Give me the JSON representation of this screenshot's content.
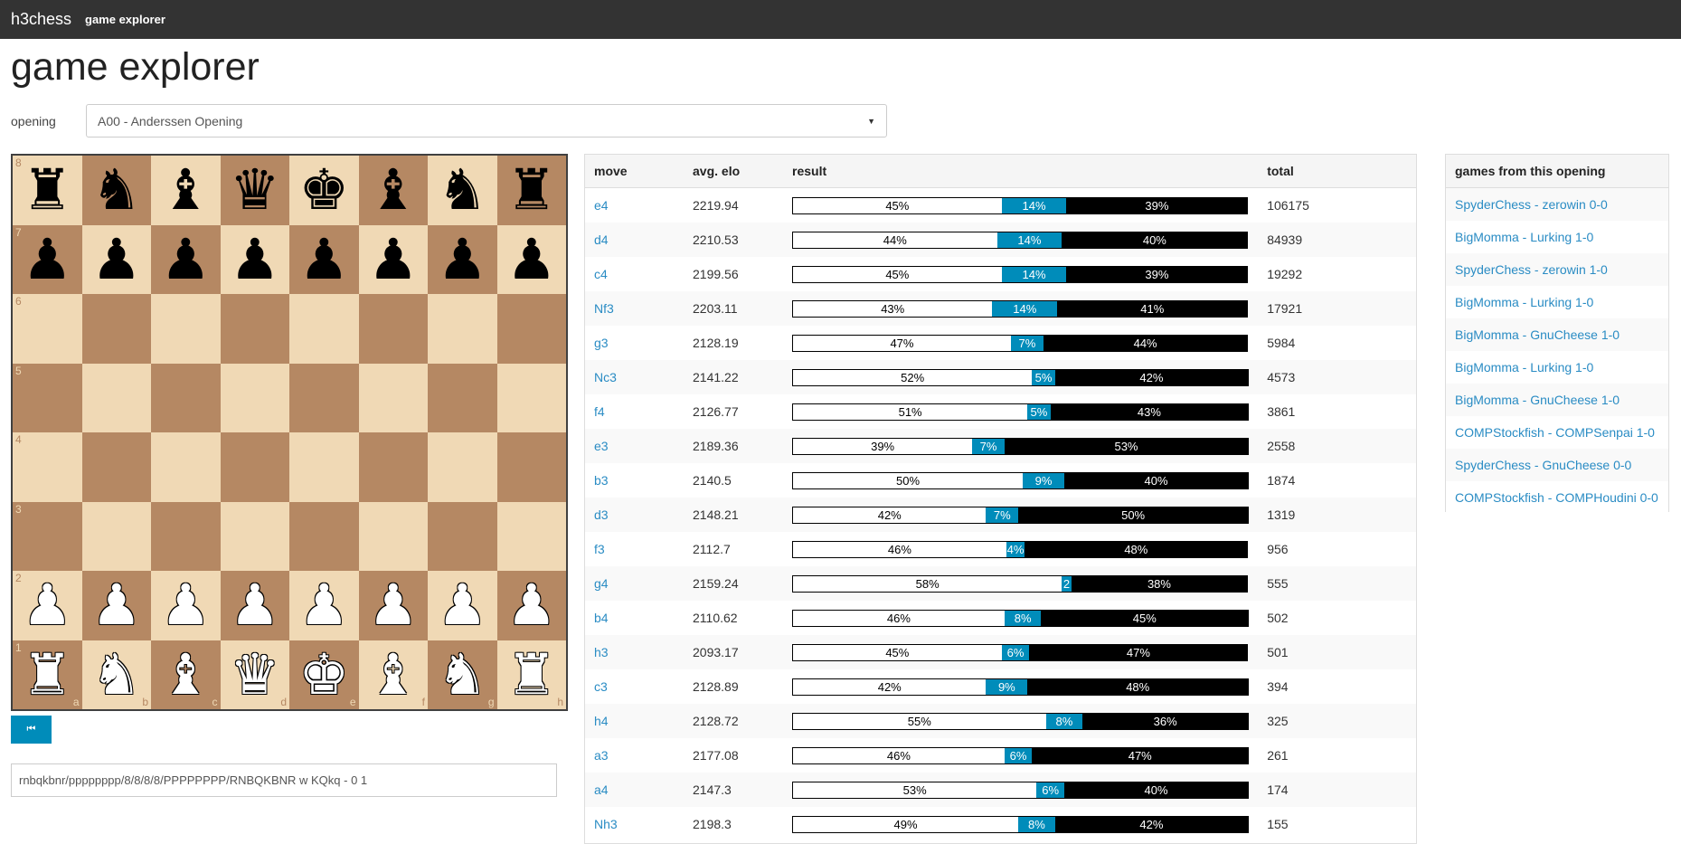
{
  "nav": {
    "brand": "h3chess",
    "link": "game explorer"
  },
  "page_title": "game explorer",
  "opening": {
    "label": "opening",
    "selected": "A00 - Anderssen Opening"
  },
  "board": {
    "ranks": [
      [
        "r",
        "n",
        "b",
        "q",
        "k",
        "b",
        "n",
        "r"
      ],
      [
        "p",
        "p",
        "p",
        "p",
        "p",
        "p",
        "p",
        "p"
      ],
      [
        "",
        "",
        "",
        "",
        "",
        "",
        "",
        ""
      ],
      [
        "",
        "",
        "",
        "",
        "",
        "",
        "",
        ""
      ],
      [
        "",
        "",
        "",
        "",
        "",
        "",
        "",
        ""
      ],
      [
        "",
        "",
        "",
        "",
        "",
        "",
        "",
        ""
      ],
      [
        "P",
        "P",
        "P",
        "P",
        "P",
        "P",
        "P",
        "P"
      ],
      [
        "R",
        "N",
        "B",
        "Q",
        "K",
        "B",
        "N",
        "R"
      ]
    ],
    "rank_labels": [
      "8",
      "7",
      "6",
      "5",
      "4",
      "3",
      "2",
      "1"
    ],
    "file_labels": [
      "a",
      "b",
      "c",
      "d",
      "e",
      "f",
      "g",
      "h"
    ]
  },
  "fen": "rnbqkbnr/pppppppp/8/8/8/8/PPPPPPPP/RNBQKBNR w KQkq - 0 1",
  "moves_table": {
    "headers": {
      "move": "move",
      "elo": "avg. elo",
      "result": "result",
      "total": "total"
    },
    "rows": [
      {
        "move": "e4",
        "elo": "2219.94",
        "w": 45,
        "d": 14,
        "b": 39,
        "w_label": "45%",
        "d_label": "14%",
        "b_label": "39%",
        "total": "106175"
      },
      {
        "move": "d4",
        "elo": "2210.53",
        "w": 44,
        "d": 14,
        "b": 40,
        "w_label": "44%",
        "d_label": "14%",
        "b_label": "40%",
        "total": "84939"
      },
      {
        "move": "c4",
        "elo": "2199.56",
        "w": 45,
        "d": 14,
        "b": 39,
        "w_label": "45%",
        "d_label": "14%",
        "b_label": "39%",
        "total": "19292"
      },
      {
        "move": "Nf3",
        "elo": "2203.11",
        "w": 43,
        "d": 14,
        "b": 41,
        "w_label": "43%",
        "d_label": "14%",
        "b_label": "41%",
        "total": "17921"
      },
      {
        "move": "g3",
        "elo": "2128.19",
        "w": 47,
        "d": 7,
        "b": 44,
        "w_label": "47%",
        "d_label": "7%",
        "b_label": "44%",
        "total": "5984"
      },
      {
        "move": "Nc3",
        "elo": "2141.22",
        "w": 52,
        "d": 5,
        "b": 42,
        "w_label": "52%",
        "d_label": "5%",
        "b_label": "42%",
        "total": "4573"
      },
      {
        "move": "f4",
        "elo": "2126.77",
        "w": 51,
        "d": 5,
        "b": 43,
        "w_label": "51%",
        "d_label": "5%",
        "b_label": "43%",
        "total": "3861"
      },
      {
        "move": "e3",
        "elo": "2189.36",
        "w": 39,
        "d": 7,
        "b": 53,
        "w_label": "39%",
        "d_label": "7%",
        "b_label": "53%",
        "total": "2558"
      },
      {
        "move": "b3",
        "elo": "2140.5",
        "w": 50,
        "d": 9,
        "b": 40,
        "w_label": "50%",
        "d_label": "9%",
        "b_label": "40%",
        "total": "1874"
      },
      {
        "move": "d3",
        "elo": "2148.21",
        "w": 42,
        "d": 7,
        "b": 50,
        "w_label": "42%",
        "d_label": "7%",
        "b_label": "50%",
        "total": "1319"
      },
      {
        "move": "f3",
        "elo": "2112.7",
        "w": 46,
        "d": 4,
        "b": 48,
        "w_label": "46%",
        "d_label": "4%",
        "b_label": "48%",
        "total": "956"
      },
      {
        "move": "g4",
        "elo": "2159.24",
        "w": 58,
        "d": 2,
        "b": 38,
        "w_label": "58%",
        "d_label": "2",
        "b_label": "38%",
        "total": "555"
      },
      {
        "move": "b4",
        "elo": "2110.62",
        "w": 46,
        "d": 8,
        "b": 45,
        "w_label": "46%",
        "d_label": "8%",
        "b_label": "45%",
        "total": "502"
      },
      {
        "move": "h3",
        "elo": "2093.17",
        "w": 45,
        "d": 6,
        "b": 47,
        "w_label": "45%",
        "d_label": "6%",
        "b_label": "47%",
        "total": "501"
      },
      {
        "move": "c3",
        "elo": "2128.89",
        "w": 42,
        "d": 9,
        "b": 48,
        "w_label": "42%",
        "d_label": "9%",
        "b_label": "48%",
        "total": "394"
      },
      {
        "move": "h4",
        "elo": "2128.72",
        "w": 55,
        "d": 8,
        "b": 36,
        "w_label": "55%",
        "d_label": "8%",
        "b_label": "36%",
        "total": "325"
      },
      {
        "move": "a3",
        "elo": "2177.08",
        "w": 46,
        "d": 6,
        "b": 47,
        "w_label": "46%",
        "d_label": "6%",
        "b_label": "47%",
        "total": "261"
      },
      {
        "move": "a4",
        "elo": "2147.3",
        "w": 53,
        "d": 6,
        "b": 40,
        "w_label": "53%",
        "d_label": "6%",
        "b_label": "40%",
        "total": "174"
      },
      {
        "move": "Nh3",
        "elo": "2198.3",
        "w": 49,
        "d": 8,
        "b": 42,
        "w_label": "49%",
        "d_label": "8%",
        "b_label": "42%",
        "total": "155"
      }
    ]
  },
  "games_panel": {
    "title": "games from this opening",
    "games": [
      "SpyderChess - zerowin 0-0",
      "BigMomma - Lurking 1-0",
      "SpyderChess - zerowin 1-0",
      "BigMomma - Lurking 1-0",
      "BigMomma - GnuCheese 1-0",
      "BigMomma - Lurking 1-0",
      "BigMomma - GnuCheese 1-0",
      "COMPStockfish - COMPSenpai 1-0",
      "SpyderChess - GnuCheese 0-0",
      "COMPStockfish - COMPHoudini 0-0"
    ]
  },
  "colors": {
    "navbar": "#333333",
    "accent": "#008cba",
    "link": "#2a8cc4",
    "light_square": "#f0d9b5",
    "dark_square": "#b58863"
  }
}
